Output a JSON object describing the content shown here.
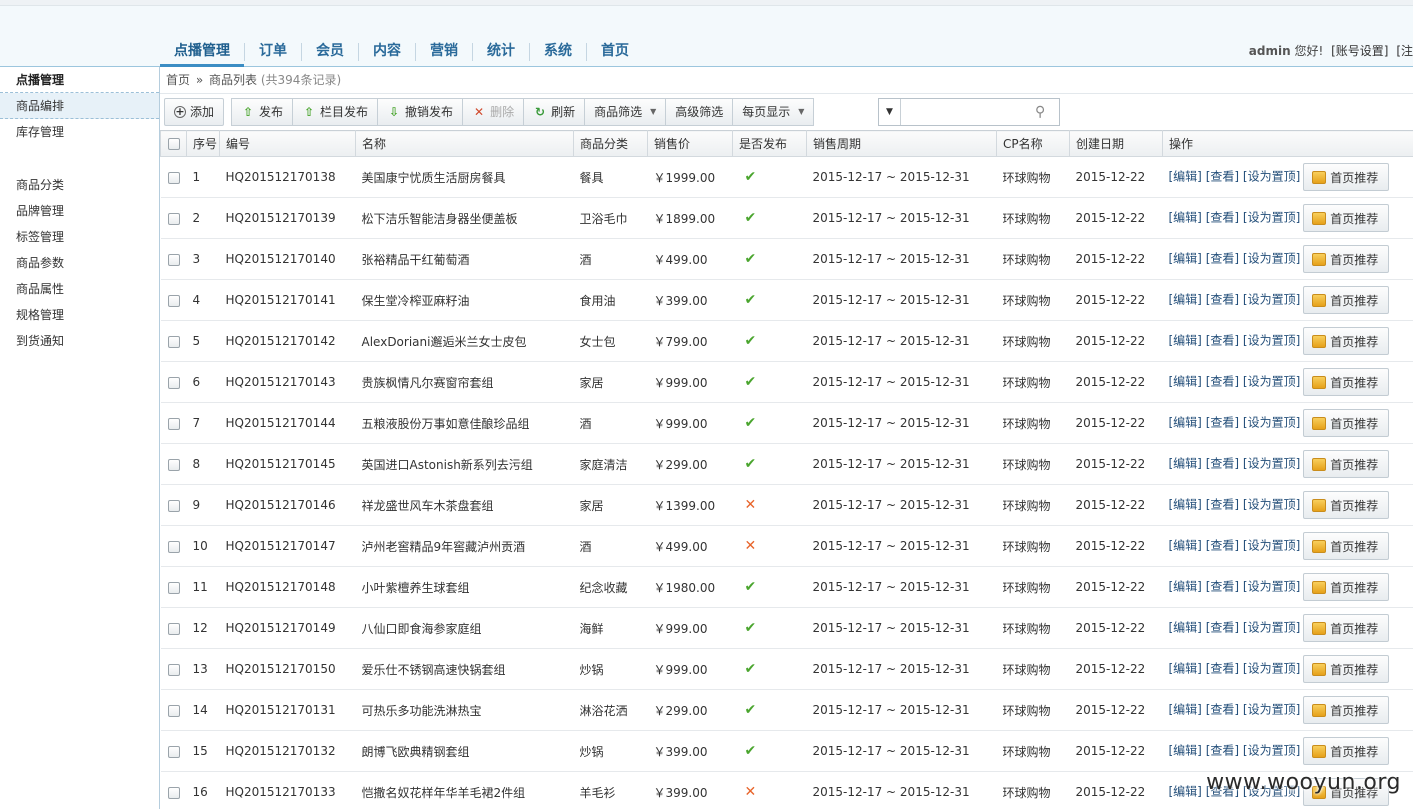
{
  "nav": {
    "items": [
      "点播管理",
      "订单",
      "会员",
      "内容",
      "营销",
      "统计",
      "系统",
      "首页"
    ],
    "active": 0
  },
  "user": {
    "name": "admin",
    "greeting": "您好!",
    "account": "[账号设置]",
    "logout_partial": "[注"
  },
  "sidebar": {
    "title": "点播管理",
    "group1": [
      "商品编排",
      "库存管理"
    ],
    "group2": [
      "商品分类",
      "品牌管理",
      "标签管理",
      "商品参数",
      "商品属性",
      "规格管理",
      "到货通知"
    ]
  },
  "breadcrumb": {
    "home": "首页",
    "sep": "»",
    "current": "商品列表",
    "count": "(共394条记录)"
  },
  "toolbar": {
    "add": "添加",
    "publish": "发布",
    "column_publish": "栏目发布",
    "unpublish": "撤销发布",
    "delete": "删除",
    "refresh": "刷新",
    "filter": "商品筛选",
    "advanced_filter": "高级筛选",
    "per_page": "每页显示"
  },
  "search": {
    "placeholder": "",
    "value": ""
  },
  "table": {
    "headers": [
      "序号",
      "编号",
      "名称",
      "商品分类",
      "销售价",
      "是否发布",
      "销售周期",
      "CP名称",
      "创建日期",
      "操作"
    ],
    "ops": {
      "edit": "[编辑]",
      "view": "[查看]",
      "top": "[设为置顶]",
      "recommend": "首页推荐"
    },
    "rows": [
      {
        "no": "1",
        "code": "HQ201512170138",
        "name": "美国康宁忧质生活厨房餐具",
        "cat": "餐具",
        "price": "￥1999.00",
        "pub": true,
        "period": "2015-12-17 ~ 2015-12-31",
        "cp": "环球购物",
        "date": "2015-12-22"
      },
      {
        "no": "2",
        "code": "HQ201512170139",
        "name": "松下洁乐智能洁身器坐便盖板",
        "cat": "卫浴毛巾",
        "price": "￥1899.00",
        "pub": true,
        "period": "2015-12-17 ~ 2015-12-31",
        "cp": "环球购物",
        "date": "2015-12-22"
      },
      {
        "no": "3",
        "code": "HQ201512170140",
        "name": "张裕精品干红葡萄酒",
        "cat": "酒",
        "price": "￥499.00",
        "pub": true,
        "period": "2015-12-17 ~ 2015-12-31",
        "cp": "环球购物",
        "date": "2015-12-22"
      },
      {
        "no": "4",
        "code": "HQ201512170141",
        "name": "保生堂冷榨亚麻籽油",
        "cat": "食用油",
        "price": "￥399.00",
        "pub": true,
        "period": "2015-12-17 ~ 2015-12-31",
        "cp": "环球购物",
        "date": "2015-12-22"
      },
      {
        "no": "5",
        "code": "HQ201512170142",
        "name": "AlexDoriani邂逅米兰女士皮包",
        "cat": "女士包",
        "price": "￥799.00",
        "pub": true,
        "period": "2015-12-17 ~ 2015-12-31",
        "cp": "环球购物",
        "date": "2015-12-22"
      },
      {
        "no": "6",
        "code": "HQ201512170143",
        "name": "贵族枫情凡尔赛窗帘套组",
        "cat": "家居",
        "price": "￥999.00",
        "pub": true,
        "period": "2015-12-17 ~ 2015-12-31",
        "cp": "环球购物",
        "date": "2015-12-22"
      },
      {
        "no": "7",
        "code": "HQ201512170144",
        "name": "五粮液股份万事如意佳酿珍品组",
        "cat": "酒",
        "price": "￥999.00",
        "pub": true,
        "period": "2015-12-17 ~ 2015-12-31",
        "cp": "环球购物",
        "date": "2015-12-22"
      },
      {
        "no": "8",
        "code": "HQ201512170145",
        "name": "英国进口Astonish新系列去污组",
        "cat": "家庭清洁",
        "price": "￥299.00",
        "pub": true,
        "period": "2015-12-17 ~ 2015-12-31",
        "cp": "环球购物",
        "date": "2015-12-22"
      },
      {
        "no": "9",
        "code": "HQ201512170146",
        "name": "祥龙盛世风车木茶盘套组",
        "cat": "家居",
        "price": "￥1399.00",
        "pub": false,
        "period": "2015-12-17 ~ 2015-12-31",
        "cp": "环球购物",
        "date": "2015-12-22"
      },
      {
        "no": "10",
        "code": "HQ201512170147",
        "name": "泸州老窖精品9年窖藏泸州贡酒",
        "cat": "酒",
        "price": "￥499.00",
        "pub": false,
        "period": "2015-12-17 ~ 2015-12-31",
        "cp": "环球购物",
        "date": "2015-12-22"
      },
      {
        "no": "11",
        "code": "HQ201512170148",
        "name": "小叶紫檀养生球套组",
        "cat": "纪念收藏",
        "price": "￥1980.00",
        "pub": true,
        "period": "2015-12-17 ~ 2015-12-31",
        "cp": "环球购物",
        "date": "2015-12-22"
      },
      {
        "no": "12",
        "code": "HQ201512170149",
        "name": "八仙口即食海参家庭组",
        "cat": "海鲜",
        "price": "￥999.00",
        "pub": true,
        "period": "2015-12-17 ~ 2015-12-31",
        "cp": "环球购物",
        "date": "2015-12-22"
      },
      {
        "no": "13",
        "code": "HQ201512170150",
        "name": "爱乐仕不锈钢高速快锅套组",
        "cat": "炒锅",
        "price": "￥999.00",
        "pub": true,
        "period": "2015-12-17 ~ 2015-12-31",
        "cp": "环球购物",
        "date": "2015-12-22"
      },
      {
        "no": "14",
        "code": "HQ201512170131",
        "name": "可热乐多功能洗淋热宝",
        "cat": "淋浴花洒",
        "price": "￥299.00",
        "pub": true,
        "period": "2015-12-17 ~ 2015-12-31",
        "cp": "环球购物",
        "date": "2015-12-22"
      },
      {
        "no": "15",
        "code": "HQ201512170132",
        "name": "朗博飞欧典精钢套组",
        "cat": "炒锅",
        "price": "￥399.00",
        "pub": true,
        "period": "2015-12-17 ~ 2015-12-31",
        "cp": "环球购物",
        "date": "2015-12-22"
      },
      {
        "no": "16",
        "code": "HQ201512170133",
        "name": "恺撒名奴花样年华羊毛裙2件组",
        "cat": "羊毛衫",
        "price": "￥399.00",
        "pub": false,
        "period": "2015-12-17 ~ 2015-12-31",
        "cp": "环球购物",
        "date": "2015-12-22"
      }
    ]
  },
  "watermark": "www.wooyun.org",
  "colors": {
    "code": "#d0282a",
    "name_link": "#2b5c88",
    "published": "#4aa52e",
    "unpublished": "#e8642a",
    "nav": "#2a6a9a"
  }
}
